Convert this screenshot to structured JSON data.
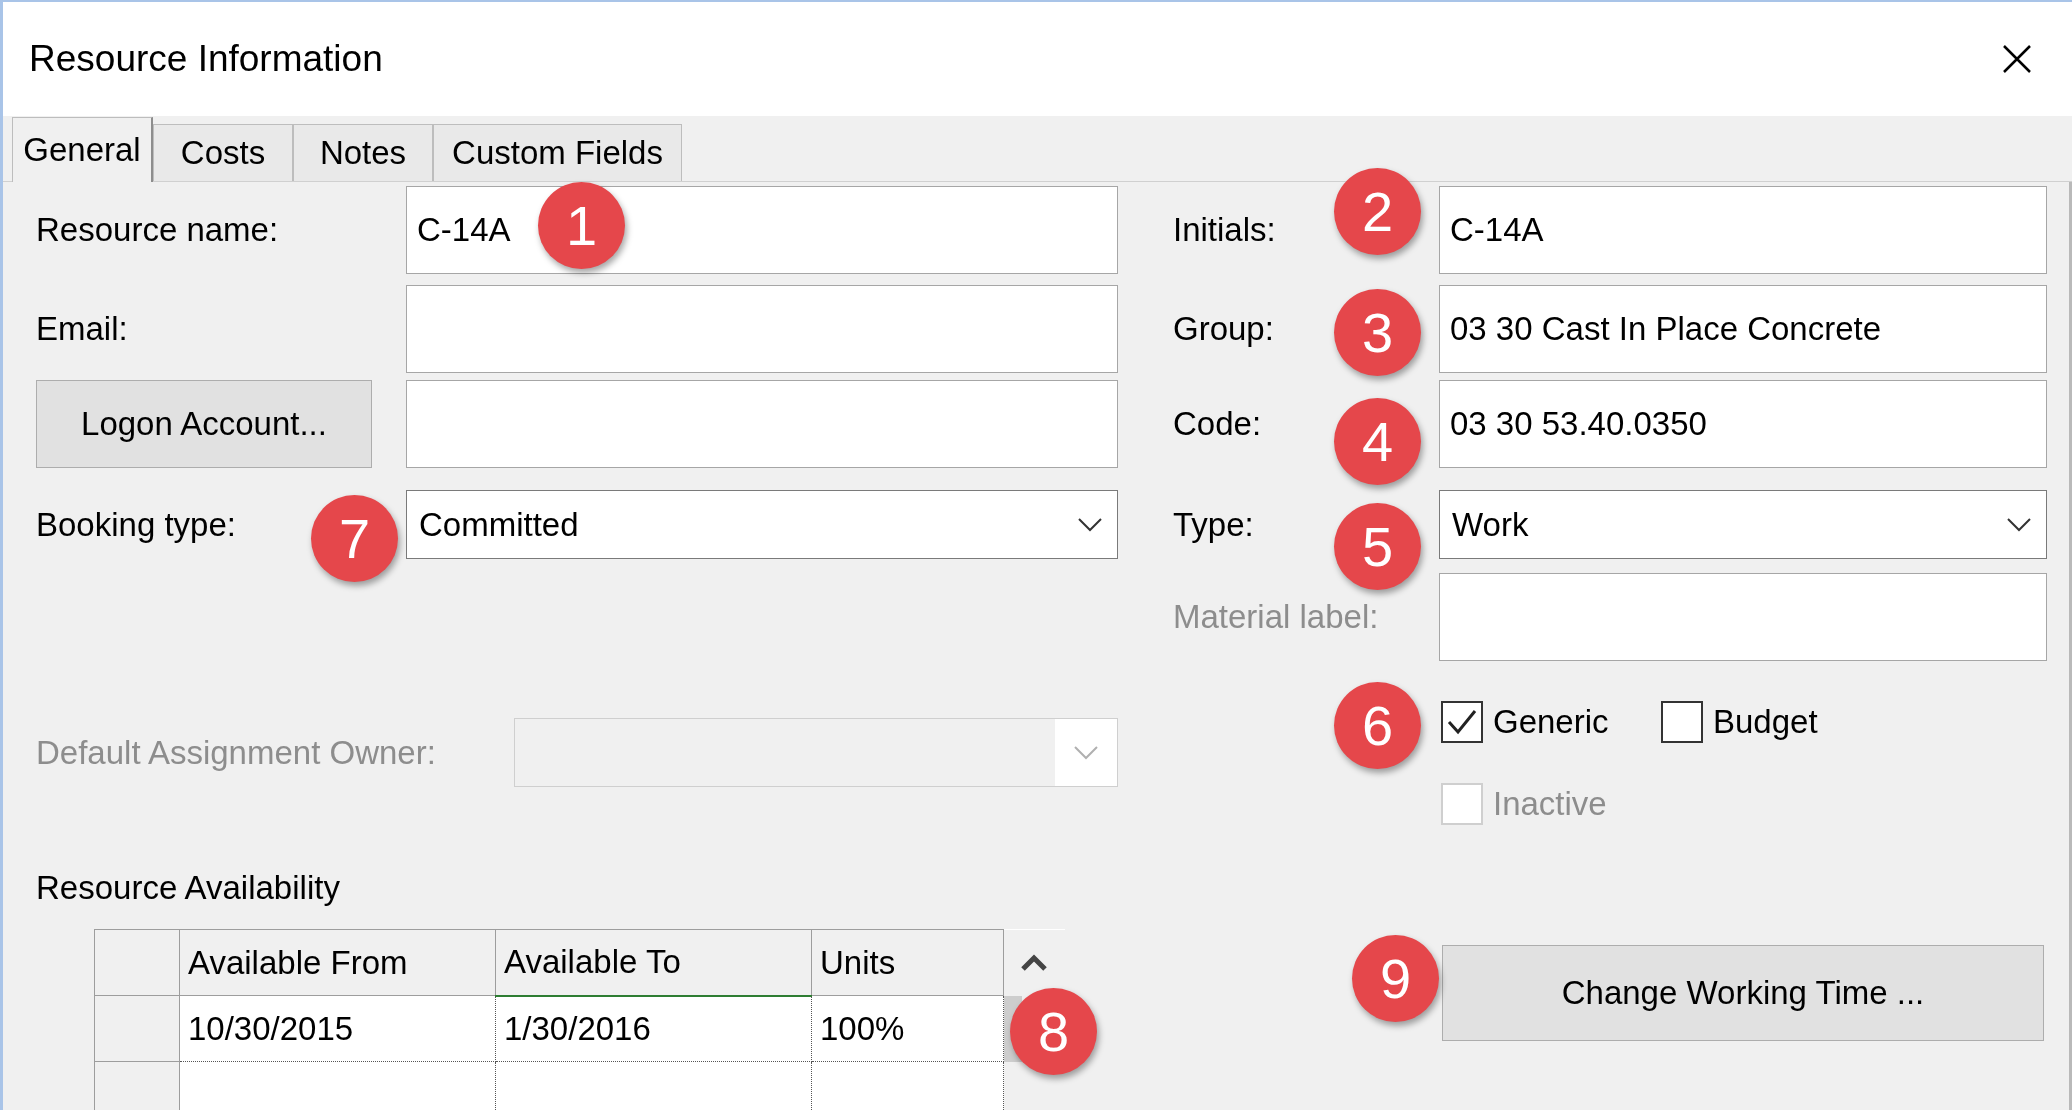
{
  "window": {
    "title": "Resource Information"
  },
  "tabs": [
    {
      "label": "General",
      "selected": true
    },
    {
      "label": "Costs",
      "selected": false
    },
    {
      "label": "Notes",
      "selected": false
    },
    {
      "label": "Custom Fields",
      "selected": false
    }
  ],
  "resource_name": {
    "label": "Resource name:",
    "value": "C-14A"
  },
  "email": {
    "label": "Email:"
  },
  "logon_account": {
    "button": "Logon Account..."
  },
  "booking_type": {
    "label": "Booking type:",
    "value": "Committed"
  },
  "default_assignment_owner": {
    "label": "Default Assignment Owner:",
    "disabled": true
  },
  "initials": {
    "label": "Initials:",
    "value": "C-14A"
  },
  "group": {
    "label": "Group:",
    "value": "03 30 Cast In Place Concrete"
  },
  "code": {
    "label": "Code:",
    "value": "03 30 53.40.0350"
  },
  "type": {
    "label": "Type:",
    "value": "Work"
  },
  "material_label": {
    "label": "Material label:",
    "disabled": true
  },
  "checkboxes": [
    {
      "label": "Generic",
      "checked": true,
      "disabled": false
    },
    {
      "label": "Budget",
      "checked": false,
      "disabled": false
    },
    {
      "label": "Inactive",
      "checked": false,
      "disabled": true
    }
  ],
  "resource_availability": {
    "title": "Resource Availability",
    "columns": [
      "Available From",
      "Available To",
      "Units"
    ],
    "rows": [
      [
        "10/30/2015",
        "1/30/2016",
        "100%"
      ]
    ]
  },
  "change_working_time": {
    "button": "Change Working Time ..."
  },
  "badges": [
    "1",
    "2",
    "3",
    "4",
    "5",
    "6",
    "7",
    "8",
    "9"
  ]
}
